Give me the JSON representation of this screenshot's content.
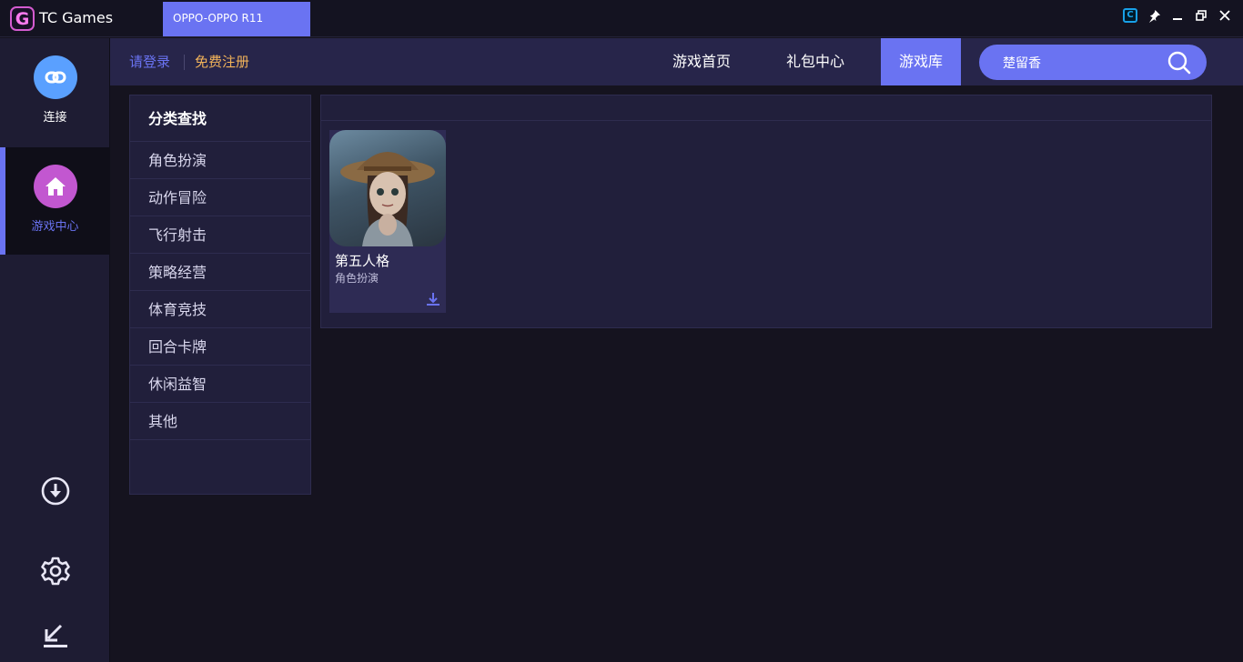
{
  "titlebar": {
    "app_name": "TC Games",
    "logo_letter": "G",
    "device_tab": "OPPO-OPPO R11",
    "controls": {
      "tc_letter": "C"
    }
  },
  "sidebar": {
    "connect_label": "连接",
    "game_center_label": "游戏中心",
    "icons": [
      "link-icon",
      "home-icon",
      "download-icon",
      "gear-icon",
      "shrink-icon"
    ]
  },
  "topnav": {
    "login": "请登录",
    "register": "免费注册",
    "tabs": [
      {
        "label": "游戏首页"
      },
      {
        "label": "礼包中心"
      },
      {
        "label": "游戏库"
      }
    ],
    "active_tab": "游戏库",
    "search_value": "楚留香"
  },
  "categories": {
    "title": "分类查找",
    "items": [
      "角色扮演",
      "动作冒险",
      "飞行射击",
      "策略经营",
      "体育竞技",
      "回合卡牌",
      "休闲益智",
      "其他"
    ]
  },
  "games": [
    {
      "name": "第五人格",
      "category": "角色扮演"
    }
  ],
  "colors": {
    "accent": "#6a73f2",
    "register": "#f2b35a",
    "connect": "#5aa0ff",
    "game_center": "#c257d0"
  }
}
